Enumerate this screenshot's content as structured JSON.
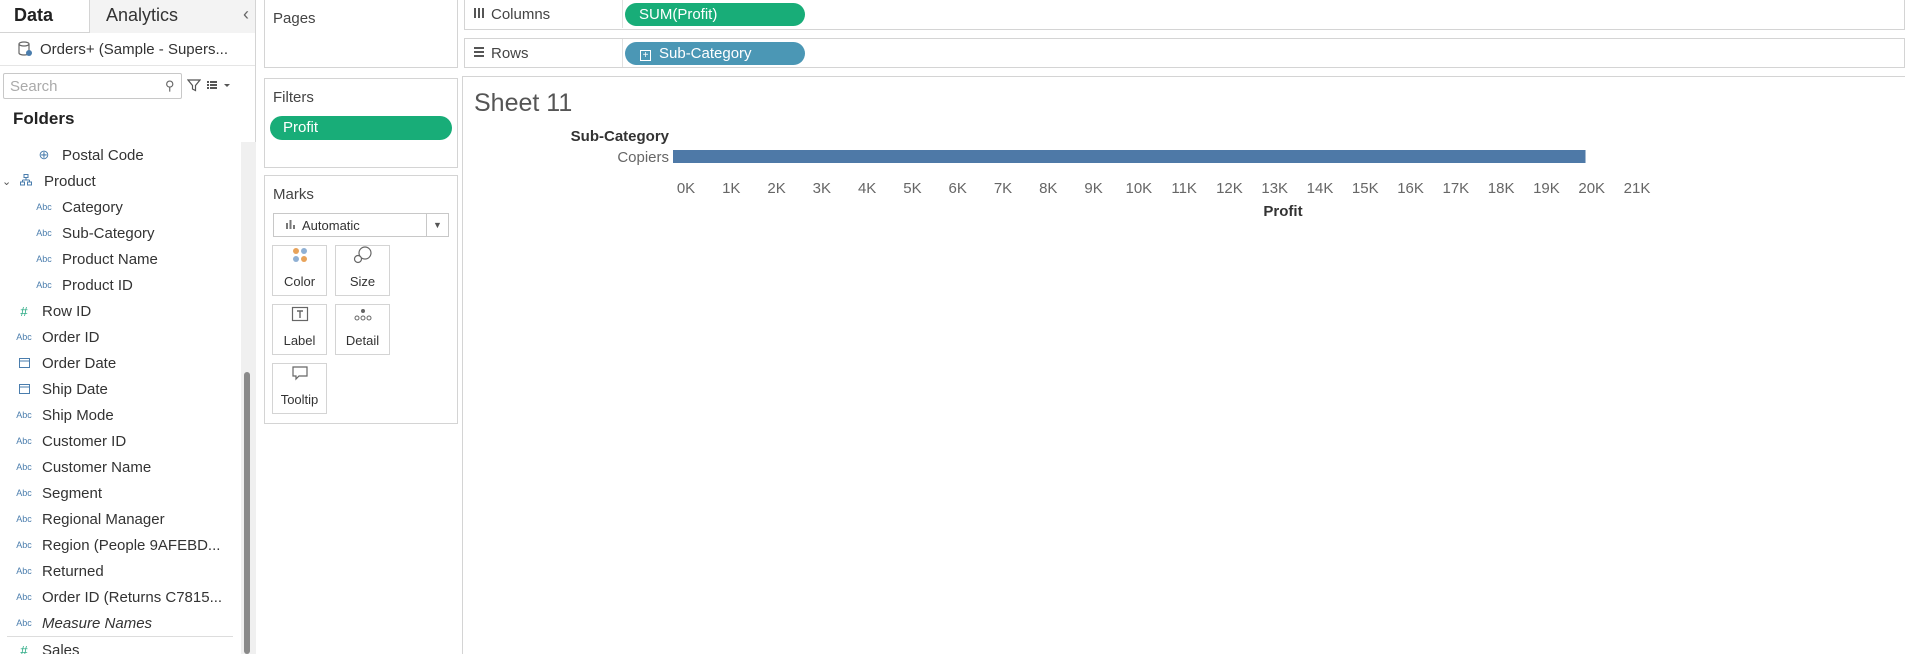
{
  "data_pane": {
    "tab_data": "Data",
    "tab_analytics": "Analytics",
    "collapse_icon": "‹",
    "datasource": "Orders+ (Sample - Supers...",
    "search_placeholder": "Search",
    "folders_label": "Folders",
    "fields": [
      {
        "label": "Postal Code",
        "type": "geo",
        "level": 1
      },
      {
        "label": "Product",
        "type": "folder",
        "level": 0
      },
      {
        "label": "Category",
        "type": "Abc",
        "level": 1
      },
      {
        "label": "Sub-Category",
        "type": "Abc",
        "level": 1
      },
      {
        "label": "Product Name",
        "type": "Abc",
        "level": 1
      },
      {
        "label": "Product ID",
        "type": "Abc",
        "level": 1
      },
      {
        "label": "Row ID",
        "type": "#",
        "level": 0
      },
      {
        "label": "Order ID",
        "type": "Abc",
        "level": 0
      },
      {
        "label": "Order Date",
        "type": "date",
        "level": 0
      },
      {
        "label": "Ship Date",
        "type": "date",
        "level": 0
      },
      {
        "label": "Ship Mode",
        "type": "Abc",
        "level": 0
      },
      {
        "label": "Customer ID",
        "type": "Abc",
        "level": 0
      },
      {
        "label": "Customer Name",
        "type": "Abc",
        "level": 0
      },
      {
        "label": "Segment",
        "type": "Abc",
        "level": 0
      },
      {
        "label": "Regional Manager",
        "type": "Abc",
        "level": 0
      },
      {
        "label": "Region (People 9AFEBD...",
        "type": "Abc",
        "level": 0
      },
      {
        "label": "Returned",
        "type": "Abc",
        "level": 0
      },
      {
        "label": "Order ID (Returns C7815...",
        "type": "Abc",
        "level": 0
      },
      {
        "label": "Measure Names",
        "type": "Abc",
        "level": 0,
        "italic": true
      },
      {
        "label": "Sales",
        "type": "#",
        "level": 0
      }
    ]
  },
  "cards": {
    "pages_title": "Pages",
    "filters_title": "Filters",
    "filter_pill": "Profit",
    "marks_title": "Marks",
    "mark_type": "Automatic",
    "mark_buttons": [
      {
        "label": "Color",
        "icon": "color-icon"
      },
      {
        "label": "Size",
        "icon": "size-icon"
      },
      {
        "label": "Label",
        "icon": "label-icon"
      },
      {
        "label": "Detail",
        "icon": "detail-icon"
      },
      {
        "label": "Tooltip",
        "icon": "tooltip-icon"
      }
    ]
  },
  "shelves": {
    "columns_label": "Columns",
    "columns_pill": "SUM(Profit)",
    "rows_label": "Rows",
    "rows_pill": "Sub-Category"
  },
  "colors": {
    "measure_pill": "#18ad78",
    "dimension_pill": "#4b97b5",
    "bar": "#4e79a7"
  },
  "view": {
    "sheet_title": "Sheet 11"
  },
  "chart_data": {
    "type": "bar",
    "orientation": "horizontal",
    "row_header": "Sub-Category",
    "categories": [
      "Copiers"
    ],
    "values": [
      20150
    ],
    "xlabel": "Profit",
    "xlim": [
      0,
      21000
    ],
    "tick_labels": [
      "0K",
      "1K",
      "2K",
      "3K",
      "4K",
      "5K",
      "6K",
      "7K",
      "8K",
      "9K",
      "10K",
      "11K",
      "12K",
      "13K",
      "14K",
      "15K",
      "16K",
      "17K",
      "18K",
      "19K",
      "20K",
      "21K"
    ],
    "grid": false
  }
}
